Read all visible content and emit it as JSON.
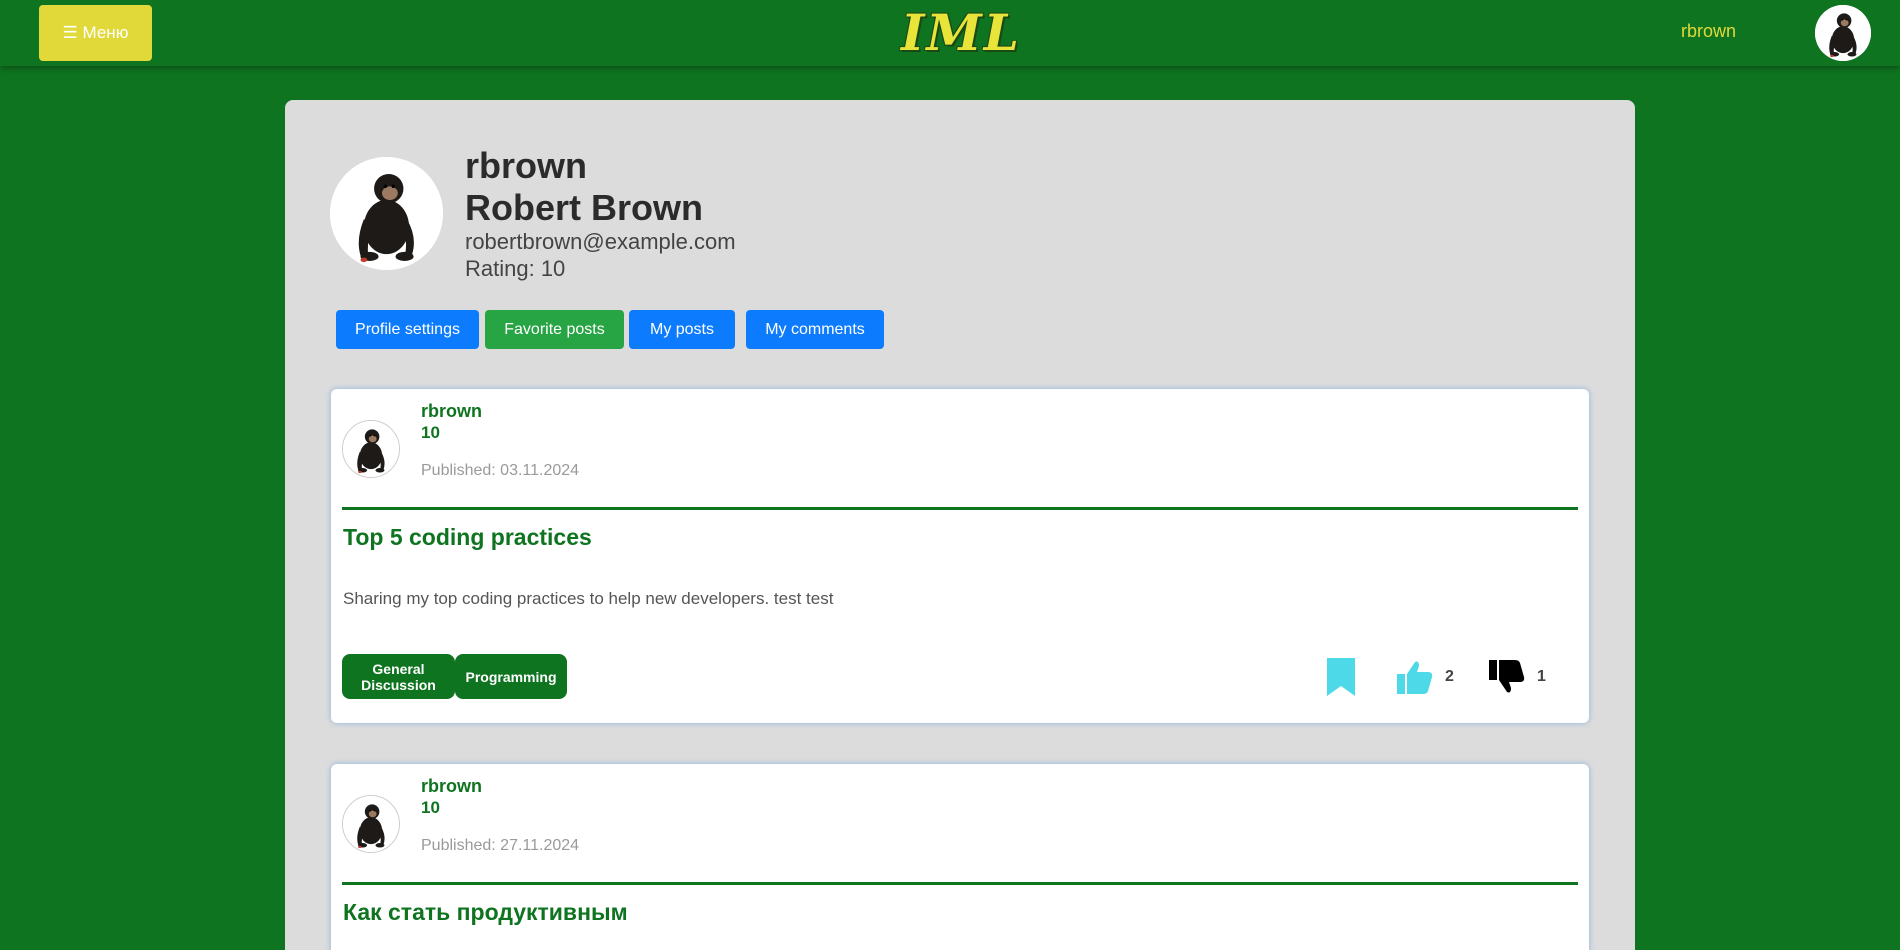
{
  "header": {
    "menu_label": "☰ Меню",
    "logo_text": "IML",
    "username": "rbrown"
  },
  "profile": {
    "username": "rbrown",
    "full_name": "Robert Brown",
    "email": "robertbrown@example.com",
    "rating": "Rating: 10"
  },
  "tabs": [
    {
      "label": "Profile settings"
    },
    {
      "label": "Favorite posts"
    },
    {
      "label": "My posts"
    },
    {
      "label": "My comments"
    }
  ],
  "posts": [
    {
      "author": "rbrown",
      "rating": "10",
      "published": "Published: 03.11.2024",
      "title": "Top 5 coding practices",
      "body": "Sharing my top coding practices to help new developers. test test",
      "tags": [
        "General Discussion",
        "Programming"
      ],
      "likes": "2",
      "dislikes": "1"
    },
    {
      "author": "rbrown",
      "rating": "10",
      "published": "Published: 27.11.2024",
      "title": "Как стать продуктивным"
    }
  ],
  "colors": {
    "background": "#0f7420",
    "accent_yellow": "#e1d93a",
    "tab_blue": "#0d7bfe",
    "tab_green": "#27a444",
    "bookmark_cyan": "#4dd9e8"
  },
  "icons": {
    "bookmark": "bookmark-icon",
    "like": "thumbs-up-icon",
    "dislike": "thumbs-down-icon"
  }
}
